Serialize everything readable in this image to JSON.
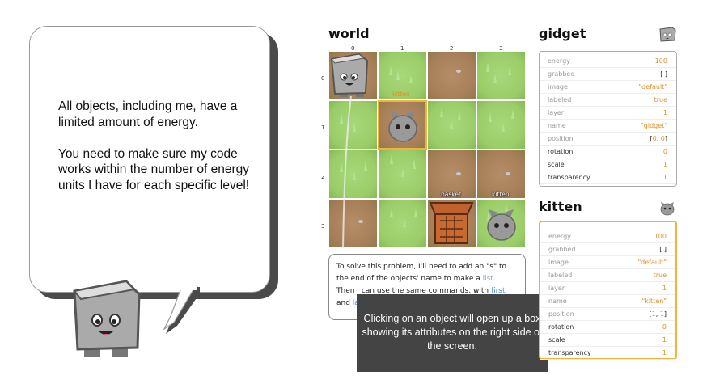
{
  "bubble": {
    "text": "All objects, including me, have a limited amount of energy.\n\nYou need to make sure my code works within the number of energy units I have for each specific level!"
  },
  "world": {
    "title": "world",
    "columns": [
      "0",
      "1",
      "2",
      "3"
    ],
    "rows": [
      "0",
      "1",
      "2",
      "3"
    ],
    "cells": [
      [
        "dirt",
        "grass",
        "dirt",
        "grass"
      ],
      [
        "grass",
        "dirt",
        "grass",
        "grass"
      ],
      [
        "grass",
        "grass",
        "dirt",
        "dirt"
      ],
      [
        "dirt",
        "grass",
        "dirt",
        "grass"
      ]
    ],
    "object_labels": {
      "kitten_top": "kitten",
      "basket": "basket",
      "kitten_bottom": "kitten"
    }
  },
  "code_box": {
    "line1": "To solve this problem, I'll need to add an \"s\" to",
    "line2a": "the end of the objects' name to make a ",
    "line2b": "list",
    "line2c": ".",
    "line3a": "Then I can use the same commands, with ",
    "line3b": "first",
    "line4a": "and ",
    "line4b": "la"
  },
  "tooltip": {
    "text": "Clicking on an object will open up a box showing its attributes on the right side of the screen."
  },
  "gidget_panel": {
    "title": "gidget",
    "attributes": [
      {
        "key": "energy",
        "value": "100"
      },
      {
        "key": "grabbed",
        "value": "[ ]"
      },
      {
        "key": "image",
        "value": "\"default\""
      },
      {
        "key": "labeled",
        "value": "true"
      },
      {
        "key": "layer",
        "value": "1"
      },
      {
        "key": "name",
        "value": "\"gidget\""
      },
      {
        "key": "position_label",
        "value": "position"
      },
      {
        "key": "rotation",
        "value": "0"
      },
      {
        "key": "scale",
        "value": "1"
      },
      {
        "key": "transparency",
        "value": "1"
      }
    ],
    "position": {
      "open": "[",
      "x": "0",
      "sep": ", ",
      "y": "0",
      "close": "]"
    }
  },
  "kitten_panel": {
    "title": "kitten",
    "attributes": [
      {
        "key": "energy",
        "value": "100"
      },
      {
        "key": "grabbed",
        "value": "[ ]"
      },
      {
        "key": "image",
        "value": "\"default\""
      },
      {
        "key": "labeled",
        "value": "true"
      },
      {
        "key": "layer",
        "value": "1"
      },
      {
        "key": "name",
        "value": "\"kitten\""
      },
      {
        "key": "position_label",
        "value": "position"
      },
      {
        "key": "rotation",
        "value": "0"
      },
      {
        "key": "scale",
        "value": "1"
      },
      {
        "key": "transparency",
        "value": "1"
      }
    ],
    "position": {
      "open": "[",
      "x": "1",
      "sep": ", ",
      "y": "1",
      "close": "]"
    }
  },
  "colors": {
    "accent": "#f0b340",
    "value_orange": "#e0902a",
    "tooltip_bg": "#444444",
    "grass": "#9acd68",
    "dirt": "#a67f58"
  }
}
